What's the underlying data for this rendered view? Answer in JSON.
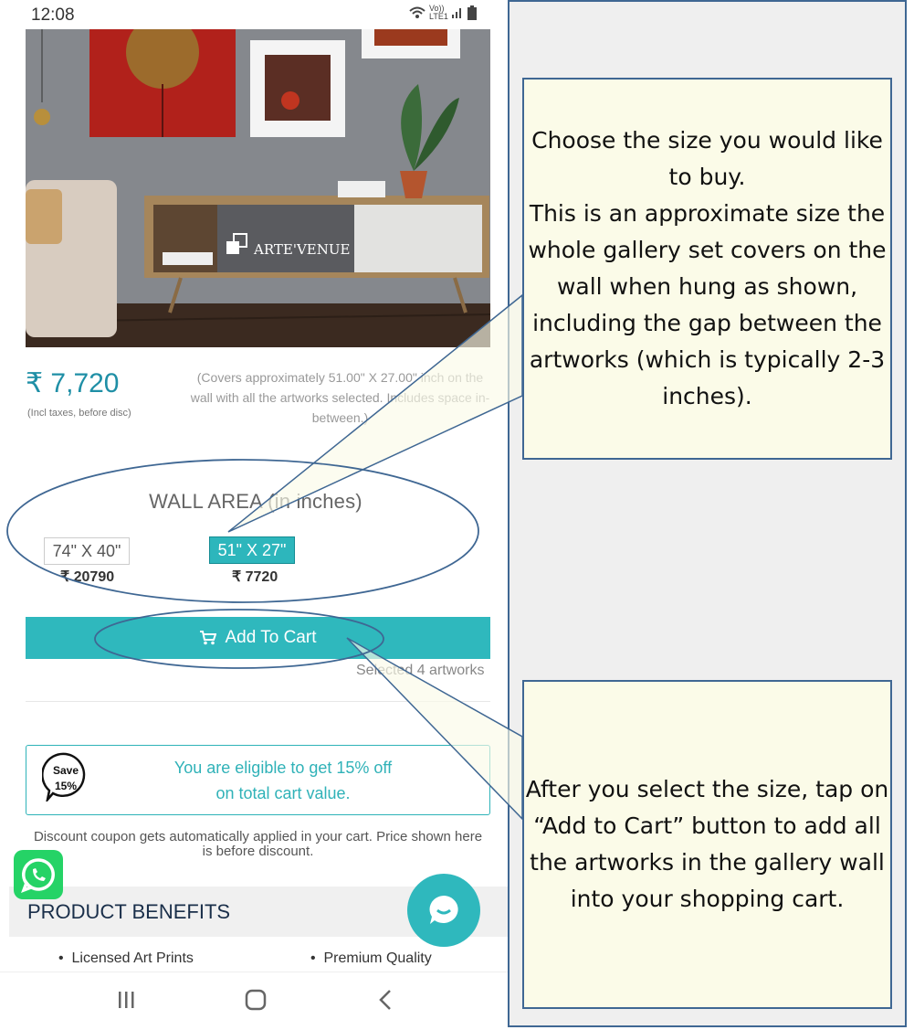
{
  "status_bar": {
    "time": "12:08",
    "network": "Vo)) LTE1"
  },
  "hero": {
    "brand": "ARTE'VENUE"
  },
  "price": {
    "value": "₹ 7,720",
    "note": "(Incl taxes, before disc)",
    "cover_note": "(Covers approximately 51.00\" X 27.00\" inch on the wall with all the artworks selected. Includes space in-between.)"
  },
  "wall_area": {
    "title": "WALL AREA (in inches)",
    "options": [
      {
        "size": "74\" X 40\"",
        "price": "₹ 20790",
        "selected": false
      },
      {
        "size": "51\" X 27\"",
        "price": "₹ 7720",
        "selected": true
      }
    ]
  },
  "cart": {
    "button_label": "Add To Cart",
    "selected_text": "Selected 4 artworks"
  },
  "offer": {
    "badge_line1": "Save",
    "badge_line2": "15%",
    "line1": "You are eligible to get 15% off",
    "line2": "on total cart value."
  },
  "discount_note": "Discount coupon gets automatically applied in your cart. Price shown here is before discount.",
  "benefits": {
    "title": "PRODUCT BENEFITS",
    "items": [
      "Licensed Art Prints",
      "Premium Quality"
    ]
  },
  "callouts": {
    "size_text": "Choose the size you would like to buy.\nThis is an approximate size the whole gallery set covers on the wall when hung as shown, including the gap between the artworks (which is typically 2-3 inches).",
    "cart_text": "After you select the size, tap on “Add to Cart” button to add all the artworks in the gallery wall into your shopping cart."
  },
  "colors": {
    "accent": "#2fb8bd",
    "price": "#1f8fa6",
    "outline": "#3f6793",
    "callout_bg": "#fbfbe8",
    "whatsapp": "#25d366"
  }
}
